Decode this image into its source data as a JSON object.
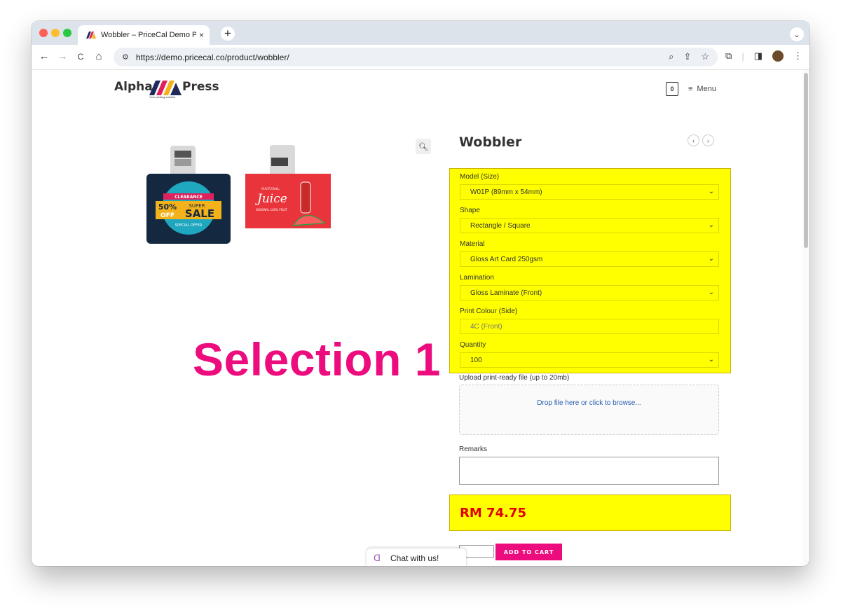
{
  "browser": {
    "tab_title": "Wobbler – PriceCal Demo Pri",
    "tab_close": "×",
    "new_tab": "+",
    "tabs_menu": "⌄",
    "url": "https://demo.pricecal.co/product/wobbler/",
    "nav": {
      "back": "←",
      "forward": "→",
      "reload": "C",
      "home": "⌂"
    }
  },
  "site": {
    "logo_left": "Alpha",
    "logo_right": "Press",
    "logo_tagline": "Your printing solution",
    "cart_count": "0",
    "menu_label": "Menu"
  },
  "product": {
    "title": "Wobbler",
    "overlay_label": "Selection 1",
    "image_texts": {
      "sale_clearance": "CLEARANCE",
      "sale_percent": "50%",
      "sale_off": "OFF",
      "sale_super": "SUPER",
      "sale_word": "SALE",
      "sale_special": "SPECIAL OFFER",
      "juice_natural": "NATURAL",
      "juice_word": "Juice",
      "juice_org": "ORIGINAL 100% FRUIT"
    }
  },
  "options": [
    {
      "label": "Model (Size)",
      "value": "W01P (89mm x 54mm)",
      "type": "select"
    },
    {
      "label": "Shape",
      "value": "Rectangle / Square",
      "type": "select"
    },
    {
      "label": "Material",
      "value": "Gloss Art Card 250gsm",
      "type": "select"
    },
    {
      "label": "Lamination",
      "value": "Gloss Laminate (Front)",
      "type": "select"
    },
    {
      "label": "Print Colour (Side)",
      "value": "4C (Front)",
      "type": "readonly"
    },
    {
      "label": "Quantity",
      "value": "100",
      "type": "select"
    }
  ],
  "upload": {
    "label": "Upload print-ready file (up to 20mb)",
    "prompt": "Drop file here or click to browse..."
  },
  "remarks": {
    "label": "Remarks"
  },
  "price": "RM 74.75",
  "add_to_cart": "ADD TO CART",
  "chat": {
    "label": "Chat with us!"
  },
  "colors": {
    "highlight": "#ffff00",
    "accent": "#ed0c7e",
    "price": "#e00000"
  }
}
